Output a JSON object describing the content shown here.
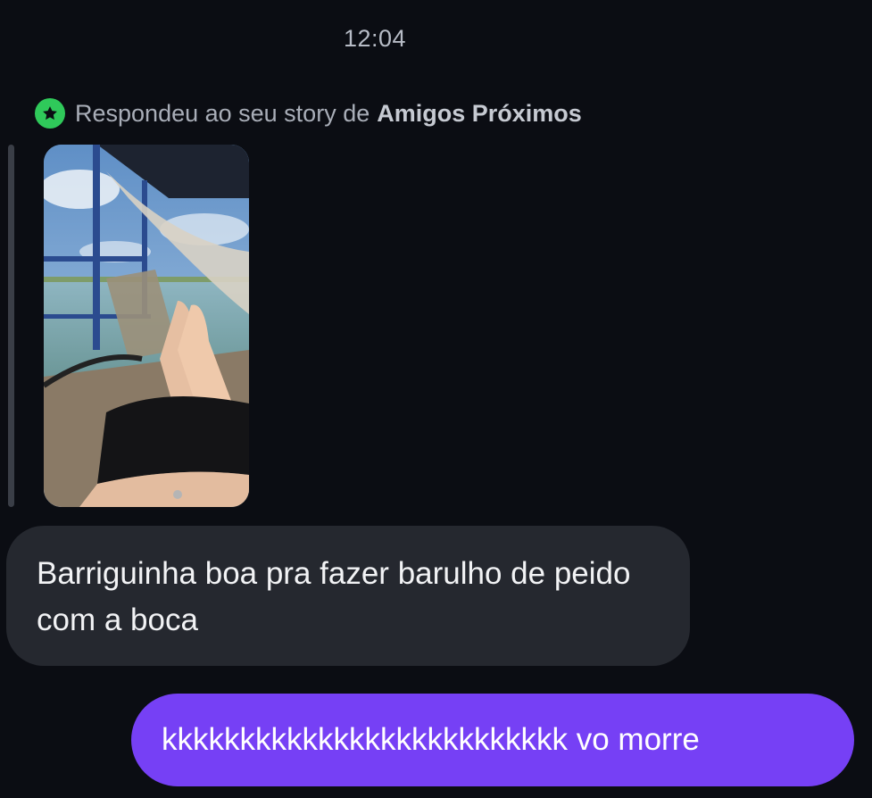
{
  "chat": {
    "timestamp": "12:04",
    "story_reply": {
      "prefix": "Respondeu ao seu story de",
      "audience": "Amigos Próximos",
      "badge_icon": "star-icon",
      "badge_color": "#2fc95a"
    },
    "messages": [
      {
        "direction": "incoming",
        "text": "Barriguinha boa pra fazer barulho de peido com a boca",
        "bubble_color": "#25282f"
      },
      {
        "direction": "outgoing",
        "text": "kkkkkkkkkkkkkkkkkkkkkkkkkk vo morre",
        "bubble_color": "#7640f5"
      }
    ]
  },
  "colors": {
    "background": "#0b0d13",
    "accent": "#7640f5",
    "close_friends_green": "#2fc95a"
  }
}
